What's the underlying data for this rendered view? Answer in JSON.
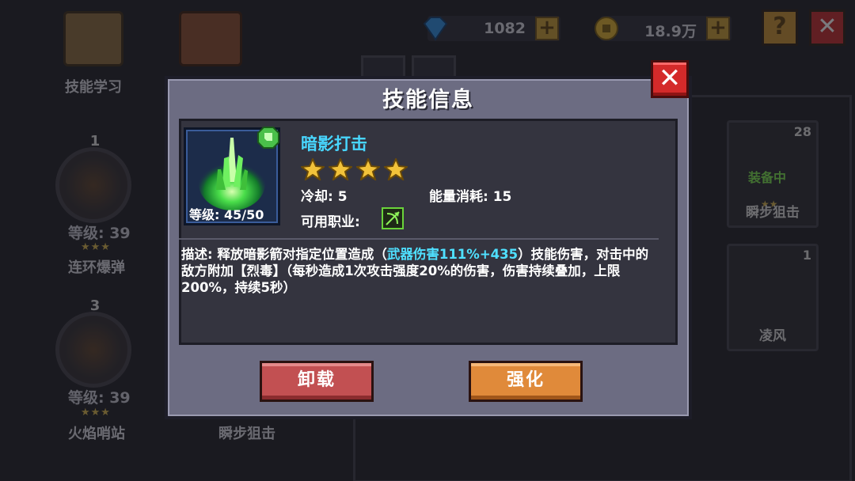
{
  "background": {
    "top_bar": {
      "diamonds": "1082",
      "gold": "18.9万",
      "help_icon": "question-icon",
      "close_icon": "close-icon"
    },
    "menu": {
      "skill_learn_label": "技能学习"
    },
    "equipped_slots": [
      {
        "num": "1",
        "level": "等级: 39",
        "stars": "★★★",
        "name": "连环爆弹"
      },
      {
        "num": "3",
        "level": "等级: 39",
        "stars": "★★★",
        "name": "火焰哨站"
      }
    ],
    "slot_name_middle": "瞬步狙击",
    "cards": [
      {
        "count": "28",
        "tag": "装备中",
        "stars": "★★",
        "name": "瞬步狙击"
      },
      {
        "count": "1",
        "name": "凌风"
      }
    ]
  },
  "modal": {
    "title": "技能信息",
    "skill": {
      "name": "暗影打击",
      "star_count": 4,
      "level": "等级: 45/50",
      "cooldown": "冷却: 5",
      "energy_cost": "能量消耗: 15",
      "usable_class_label": "可用职业:",
      "usable_class_icon": "bow-class-icon"
    },
    "description": {
      "prefix": "描述: 释放暗影箭对指定位置造成（",
      "highlight": "武器伤害111%+435",
      "suffix": "）技能伤害，对击中的敌方附加【烈毒】（每秒造成1次攻击强度20%的伤害，伤害持续叠加，上限200%，持续5秒）"
    },
    "buttons": {
      "uninstall": "卸载",
      "enhance": "强化"
    }
  },
  "colors": {
    "skill_name": "#48d6ff",
    "highlight": "#4fe0ff",
    "close_red": "#d42a2a",
    "uninstall_red": "#c25052",
    "enhance_orange": "#e08a3a",
    "star_gold": "#f2c23a"
  }
}
